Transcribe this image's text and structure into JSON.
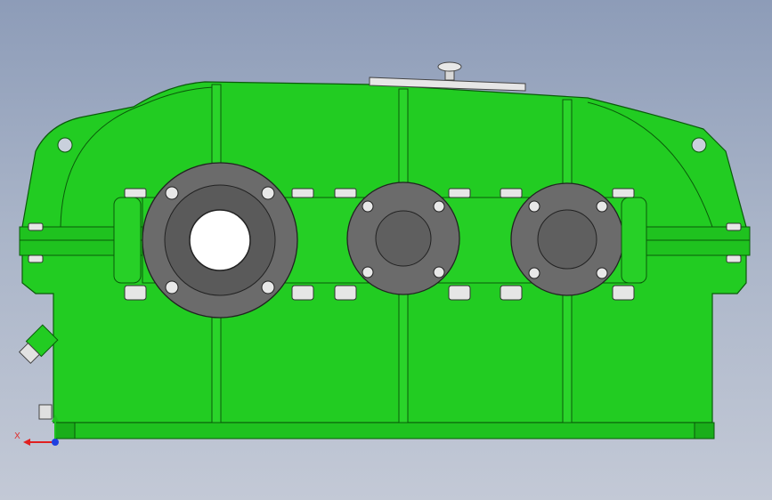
{
  "view": {
    "axis_x_label": "X"
  },
  "colors": {
    "housing": "#22cc22",
    "housing_dark": "#149a14",
    "flange": "#6b6b6b",
    "flange_dark": "#4d4d4d",
    "bolt": "#e8e8e8",
    "bore": "#ffffff",
    "axis_x": "#e02020",
    "axis_y": "#20c020",
    "axis_z": "#2040e0"
  },
  "model": {
    "part": "gear-reducer-housing",
    "shafts": [
      "input-shaft-bearing",
      "intermediate-shaft-bearing",
      "output-shaft-bearing"
    ]
  }
}
